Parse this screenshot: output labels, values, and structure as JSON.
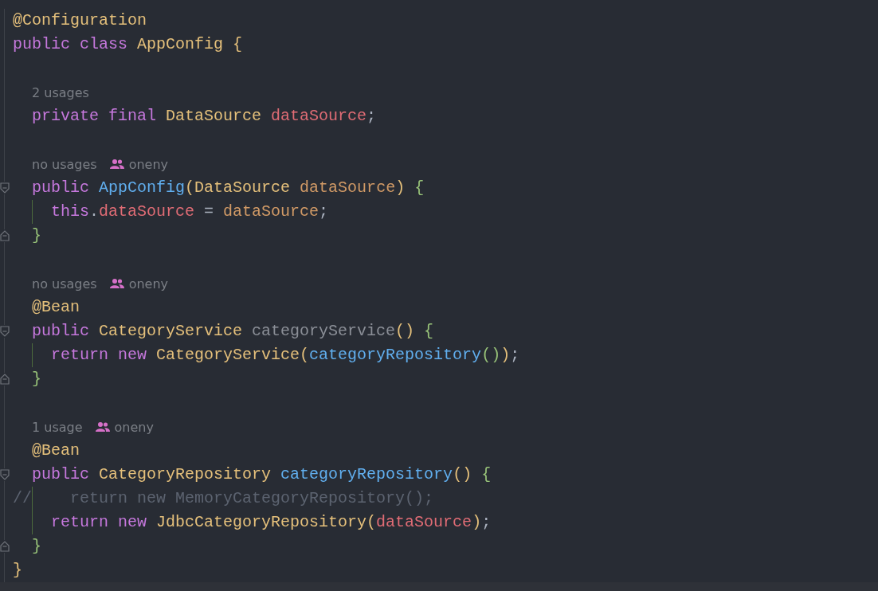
{
  "editor": {
    "lines": [
      {
        "kind": "code",
        "tokens": [
          {
            "text": "@Configuration",
            "color": "#e5c07b"
          }
        ]
      },
      {
        "kind": "code",
        "tokens": [
          {
            "text": "public class ",
            "color": "#c678dd"
          },
          {
            "text": "AppConfig ",
            "color": "#e5c07b"
          },
          {
            "text": "{",
            "color": "#e5c07b"
          }
        ]
      },
      {
        "kind": "blank"
      },
      {
        "kind": "hint",
        "usages": "2 usages"
      },
      {
        "kind": "code",
        "tokens": [
          {
            "text": "  private final ",
            "color": "#c678dd"
          },
          {
            "text": "DataSource ",
            "color": "#e5c07b"
          },
          {
            "text": "dataSource",
            "color": "#e06c75"
          },
          {
            "text": ";",
            "color": "#abb2bf"
          }
        ]
      },
      {
        "kind": "blank"
      },
      {
        "kind": "hint",
        "usages": "no usages",
        "author": "oneny"
      },
      {
        "kind": "code",
        "fold_open": true,
        "tokens": [
          {
            "text": "  public ",
            "color": "#c678dd"
          },
          {
            "text": "AppConfig",
            "color": "#61afef"
          },
          {
            "text": "(",
            "color": "#e5c07b"
          },
          {
            "text": "DataSource ",
            "color": "#e5c07b"
          },
          {
            "text": "dataSource",
            "color": "#d19a66"
          },
          {
            "text": ") ",
            "color": "#e5c07b"
          },
          {
            "text": "{",
            "color": "#98c379"
          }
        ]
      },
      {
        "kind": "code",
        "guide": true,
        "tokens": [
          {
            "text": "    this",
            "color": "#c678dd"
          },
          {
            "text": ".",
            "color": "#abb2bf"
          },
          {
            "text": "dataSource",
            "color": "#e06c75"
          },
          {
            "text": " = ",
            "color": "#abb2bf"
          },
          {
            "text": "dataSource",
            "color": "#d19a66"
          },
          {
            "text": ";",
            "color": "#abb2bf"
          }
        ]
      },
      {
        "kind": "code",
        "fold_close": true,
        "tokens": [
          {
            "text": "  }",
            "color": "#98c379"
          }
        ]
      },
      {
        "kind": "blank"
      },
      {
        "kind": "hint",
        "usages": "no usages",
        "author": "oneny"
      },
      {
        "kind": "code",
        "tokens": [
          {
            "text": "  @Bean",
            "color": "#e5c07b"
          }
        ]
      },
      {
        "kind": "code",
        "fold_open": true,
        "tokens": [
          {
            "text": "  public ",
            "color": "#c678dd"
          },
          {
            "text": "CategoryService ",
            "color": "#e5c07b"
          },
          {
            "text": "categoryService",
            "color": "#8b8f97"
          },
          {
            "text": "() ",
            "color": "#e5c07b"
          },
          {
            "text": "{",
            "color": "#98c379"
          }
        ]
      },
      {
        "kind": "code",
        "guide": true,
        "tokens": [
          {
            "text": "    return new ",
            "color": "#c678dd"
          },
          {
            "text": "CategoryService",
            "color": "#e5c07b"
          },
          {
            "text": "(",
            "color": "#e5c07b"
          },
          {
            "text": "categoryRepository",
            "color": "#61afef"
          },
          {
            "text": "()",
            "color": "#98c379"
          },
          {
            "text": ")",
            "color": "#e5c07b"
          },
          {
            "text": ";",
            "color": "#abb2bf"
          }
        ]
      },
      {
        "kind": "code",
        "fold_close": true,
        "tokens": [
          {
            "text": "  }",
            "color": "#98c379"
          }
        ]
      },
      {
        "kind": "blank"
      },
      {
        "kind": "hint",
        "usages": "1 usage",
        "author": "oneny"
      },
      {
        "kind": "code",
        "tokens": [
          {
            "text": "  @Bean",
            "color": "#e5c07b"
          }
        ]
      },
      {
        "kind": "code",
        "fold_open": true,
        "tokens": [
          {
            "text": "  public ",
            "color": "#c678dd"
          },
          {
            "text": "CategoryRepository ",
            "color": "#e5c07b"
          },
          {
            "text": "categoryRepository",
            "color": "#61afef"
          },
          {
            "text": "() ",
            "color": "#e5c07b"
          },
          {
            "text": "{",
            "color": "#98c379"
          }
        ]
      },
      {
        "kind": "code",
        "guide": true,
        "tokens": [
          {
            "text": "//    return new MemoryCategoryRepository();",
            "color": "#5c6370"
          }
        ]
      },
      {
        "kind": "code",
        "guide": true,
        "tokens": [
          {
            "text": "    return new ",
            "color": "#c678dd"
          },
          {
            "text": "JdbcCategoryRepository",
            "color": "#e5c07b"
          },
          {
            "text": "(",
            "color": "#e5c07b"
          },
          {
            "text": "dataSource",
            "color": "#e06c75"
          },
          {
            "text": ")",
            "color": "#e5c07b"
          },
          {
            "text": ";",
            "color": "#abb2bf"
          }
        ]
      },
      {
        "kind": "code",
        "fold_close": true,
        "tokens": [
          {
            "text": "  }",
            "color": "#98c379"
          }
        ]
      },
      {
        "kind": "code",
        "tokens": [
          {
            "text": "}",
            "color": "#e5c07b"
          }
        ]
      }
    ]
  }
}
